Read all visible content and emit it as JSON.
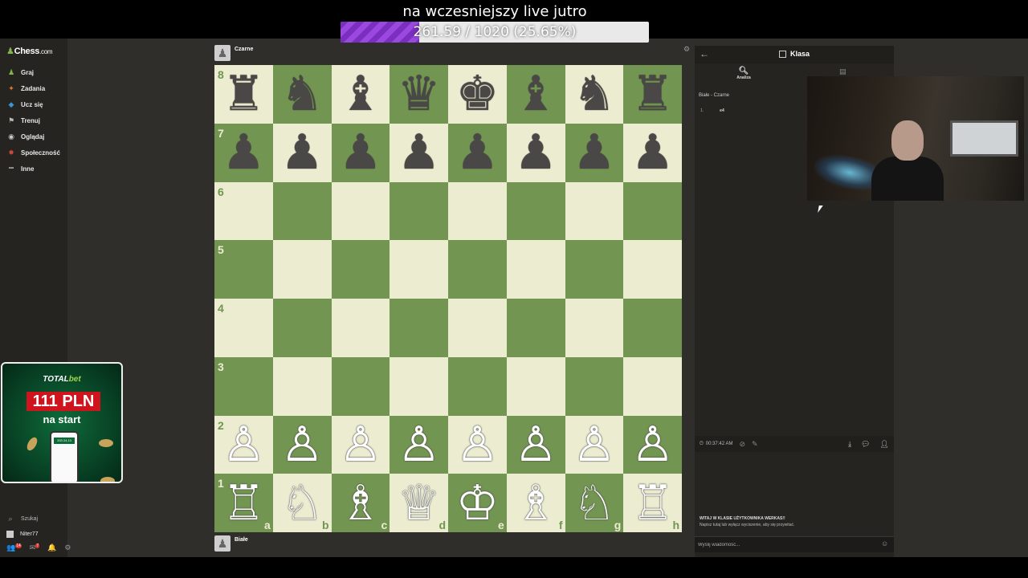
{
  "overlay": {
    "title": "na wczesniejszy live jutro",
    "goal_text": "261.59 / 1020 (25.65%)",
    "goal_progress_pct": 25.65,
    "goal_fill_color": "#7b2fbf"
  },
  "sidebar": {
    "logo_main": "Chess",
    "logo_suffix": ".com",
    "items": [
      {
        "label": "Graj",
        "icon": "play-pawn-icon",
        "color": "#81b64c"
      },
      {
        "label": "Zadania",
        "icon": "puzzle-icon",
        "color": "#e5762a"
      },
      {
        "label": "Ucz się",
        "icon": "learn-cap-icon",
        "color": "#3a94d6"
      },
      {
        "label": "Trenuj",
        "icon": "train-icon",
        "color": "#bbbbbb"
      },
      {
        "label": "Oglądaj",
        "icon": "watch-binoculars-icon",
        "color": "#c8c8c8"
      },
      {
        "label": "Społeczność",
        "icon": "community-icon",
        "color": "#ce4b3c"
      },
      {
        "label": "Inne",
        "icon": "more-dots-icon",
        "color": "#cccccc"
      }
    ],
    "search_label": "Szukaj",
    "username": "Niter77",
    "badges": {
      "notifications": "14",
      "messages": "7"
    }
  },
  "ad": {
    "brand_left": "TOTAL",
    "brand_right": "bet",
    "amount": "111 PLN",
    "subtitle": "na start",
    "phone_screen": "333 24,13"
  },
  "game": {
    "top_player": "Czarne",
    "bottom_player": "Białe",
    "ranks": [
      "8",
      "7",
      "6",
      "5",
      "4",
      "3",
      "2",
      "1"
    ],
    "files": [
      "a",
      "b",
      "c",
      "d",
      "e",
      "f",
      "g",
      "h"
    ],
    "position": [
      [
        "♜",
        "♞",
        "♝",
        "♛",
        "♚",
        "♝",
        "♞",
        "♜"
      ],
      [
        "♟",
        "♟",
        "♟",
        "♟",
        "♟",
        "♟",
        "♟",
        "♟"
      ],
      [
        "",
        "",
        "",
        "",
        "",
        "",
        "",
        ""
      ],
      [
        "",
        "",
        "",
        "",
        "",
        "",
        "",
        ""
      ],
      [
        "",
        "",
        "",
        "",
        "",
        "",
        "",
        ""
      ],
      [
        "",
        "",
        "",
        "",
        "",
        "",
        "",
        ""
      ],
      [
        "♙",
        "♙",
        "♙",
        "♙",
        "♙",
        "♙",
        "♙",
        "♙"
      ],
      [
        "♖",
        "♘",
        "♗",
        "♕",
        "♔",
        "♗",
        "♘",
        "♖"
      ]
    ],
    "light_color": "#ebecd0",
    "dark_color": "#739552"
  },
  "panel": {
    "title": "Klasa",
    "tab_analysis": "Analiza",
    "players_line": "Białe - Czarne",
    "moves": [
      {
        "num": "1.",
        "white": "e4"
      }
    ],
    "time": "00:37:42 AM",
    "welcome_title": "WITAJ W KLASIE UŻYTKOWNIKA WERKAS!!",
    "welcome_text": "Napisz tutaj lub wyłącz wyciszenie, aby się przywitać.",
    "chat_placeholder": "Wyślij wiadomość..."
  }
}
